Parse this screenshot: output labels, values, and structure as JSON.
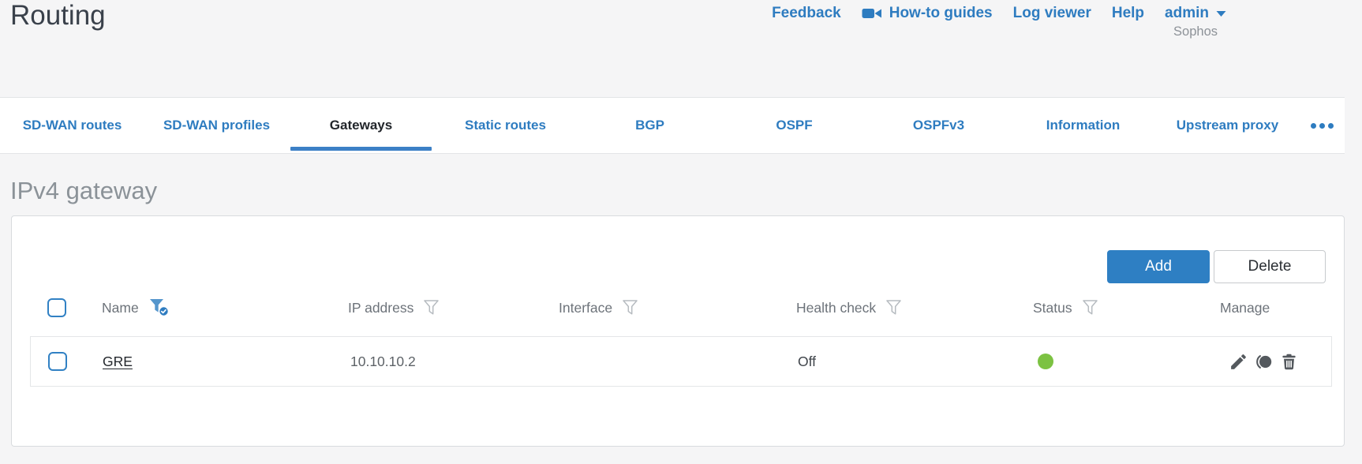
{
  "page": {
    "title": "Routing",
    "brand": "Sophos",
    "section_title": "IPv4 gateway"
  },
  "colors": {
    "accent_blue": "#2e7cc0",
    "button_blue": "#2e7fc3",
    "status_green": "#7cc242",
    "icon_gray": "#54595e"
  },
  "utility_nav": {
    "items": [
      {
        "label": "Feedback"
      },
      {
        "label": "How-to guides",
        "icon": "video-camera-icon"
      },
      {
        "label": "Log viewer"
      },
      {
        "label": "Help"
      },
      {
        "label": "admin",
        "icon": "caret-down-icon"
      }
    ]
  },
  "tabs": {
    "items": [
      {
        "label": "SD-WAN routes",
        "active": false
      },
      {
        "label": "SD-WAN profiles",
        "active": false
      },
      {
        "label": "Gateways",
        "active": true
      },
      {
        "label": "Static routes",
        "active": false
      },
      {
        "label": "BGP",
        "active": false
      },
      {
        "label": "OSPF",
        "active": false
      },
      {
        "label": "OSPFv3",
        "active": false
      },
      {
        "label": "Information",
        "active": false
      },
      {
        "label": "Upstream proxy",
        "active": false
      }
    ],
    "more_icon": "ellipsis-icon"
  },
  "toolbar": {
    "add_label": "Add",
    "delete_label": "Delete"
  },
  "gateway_table": {
    "columns": [
      {
        "label": "Name",
        "filter": "active"
      },
      {
        "label": "IP address",
        "filter": "inactive"
      },
      {
        "label": "Interface",
        "filter": "inactive"
      },
      {
        "label": "Health check",
        "filter": "inactive"
      },
      {
        "label": "Status",
        "filter": "inactive"
      },
      {
        "label": "Manage",
        "filter": "none"
      }
    ],
    "rows": [
      {
        "name": "GRE",
        "ip_address": "10.10.10.2",
        "interface": "",
        "health_check": "Off",
        "status_color": "#7cc242",
        "manage_icons": [
          "edit-pencil-icon",
          "eclipse-usage-icon",
          "trash-icon"
        ]
      }
    ]
  }
}
